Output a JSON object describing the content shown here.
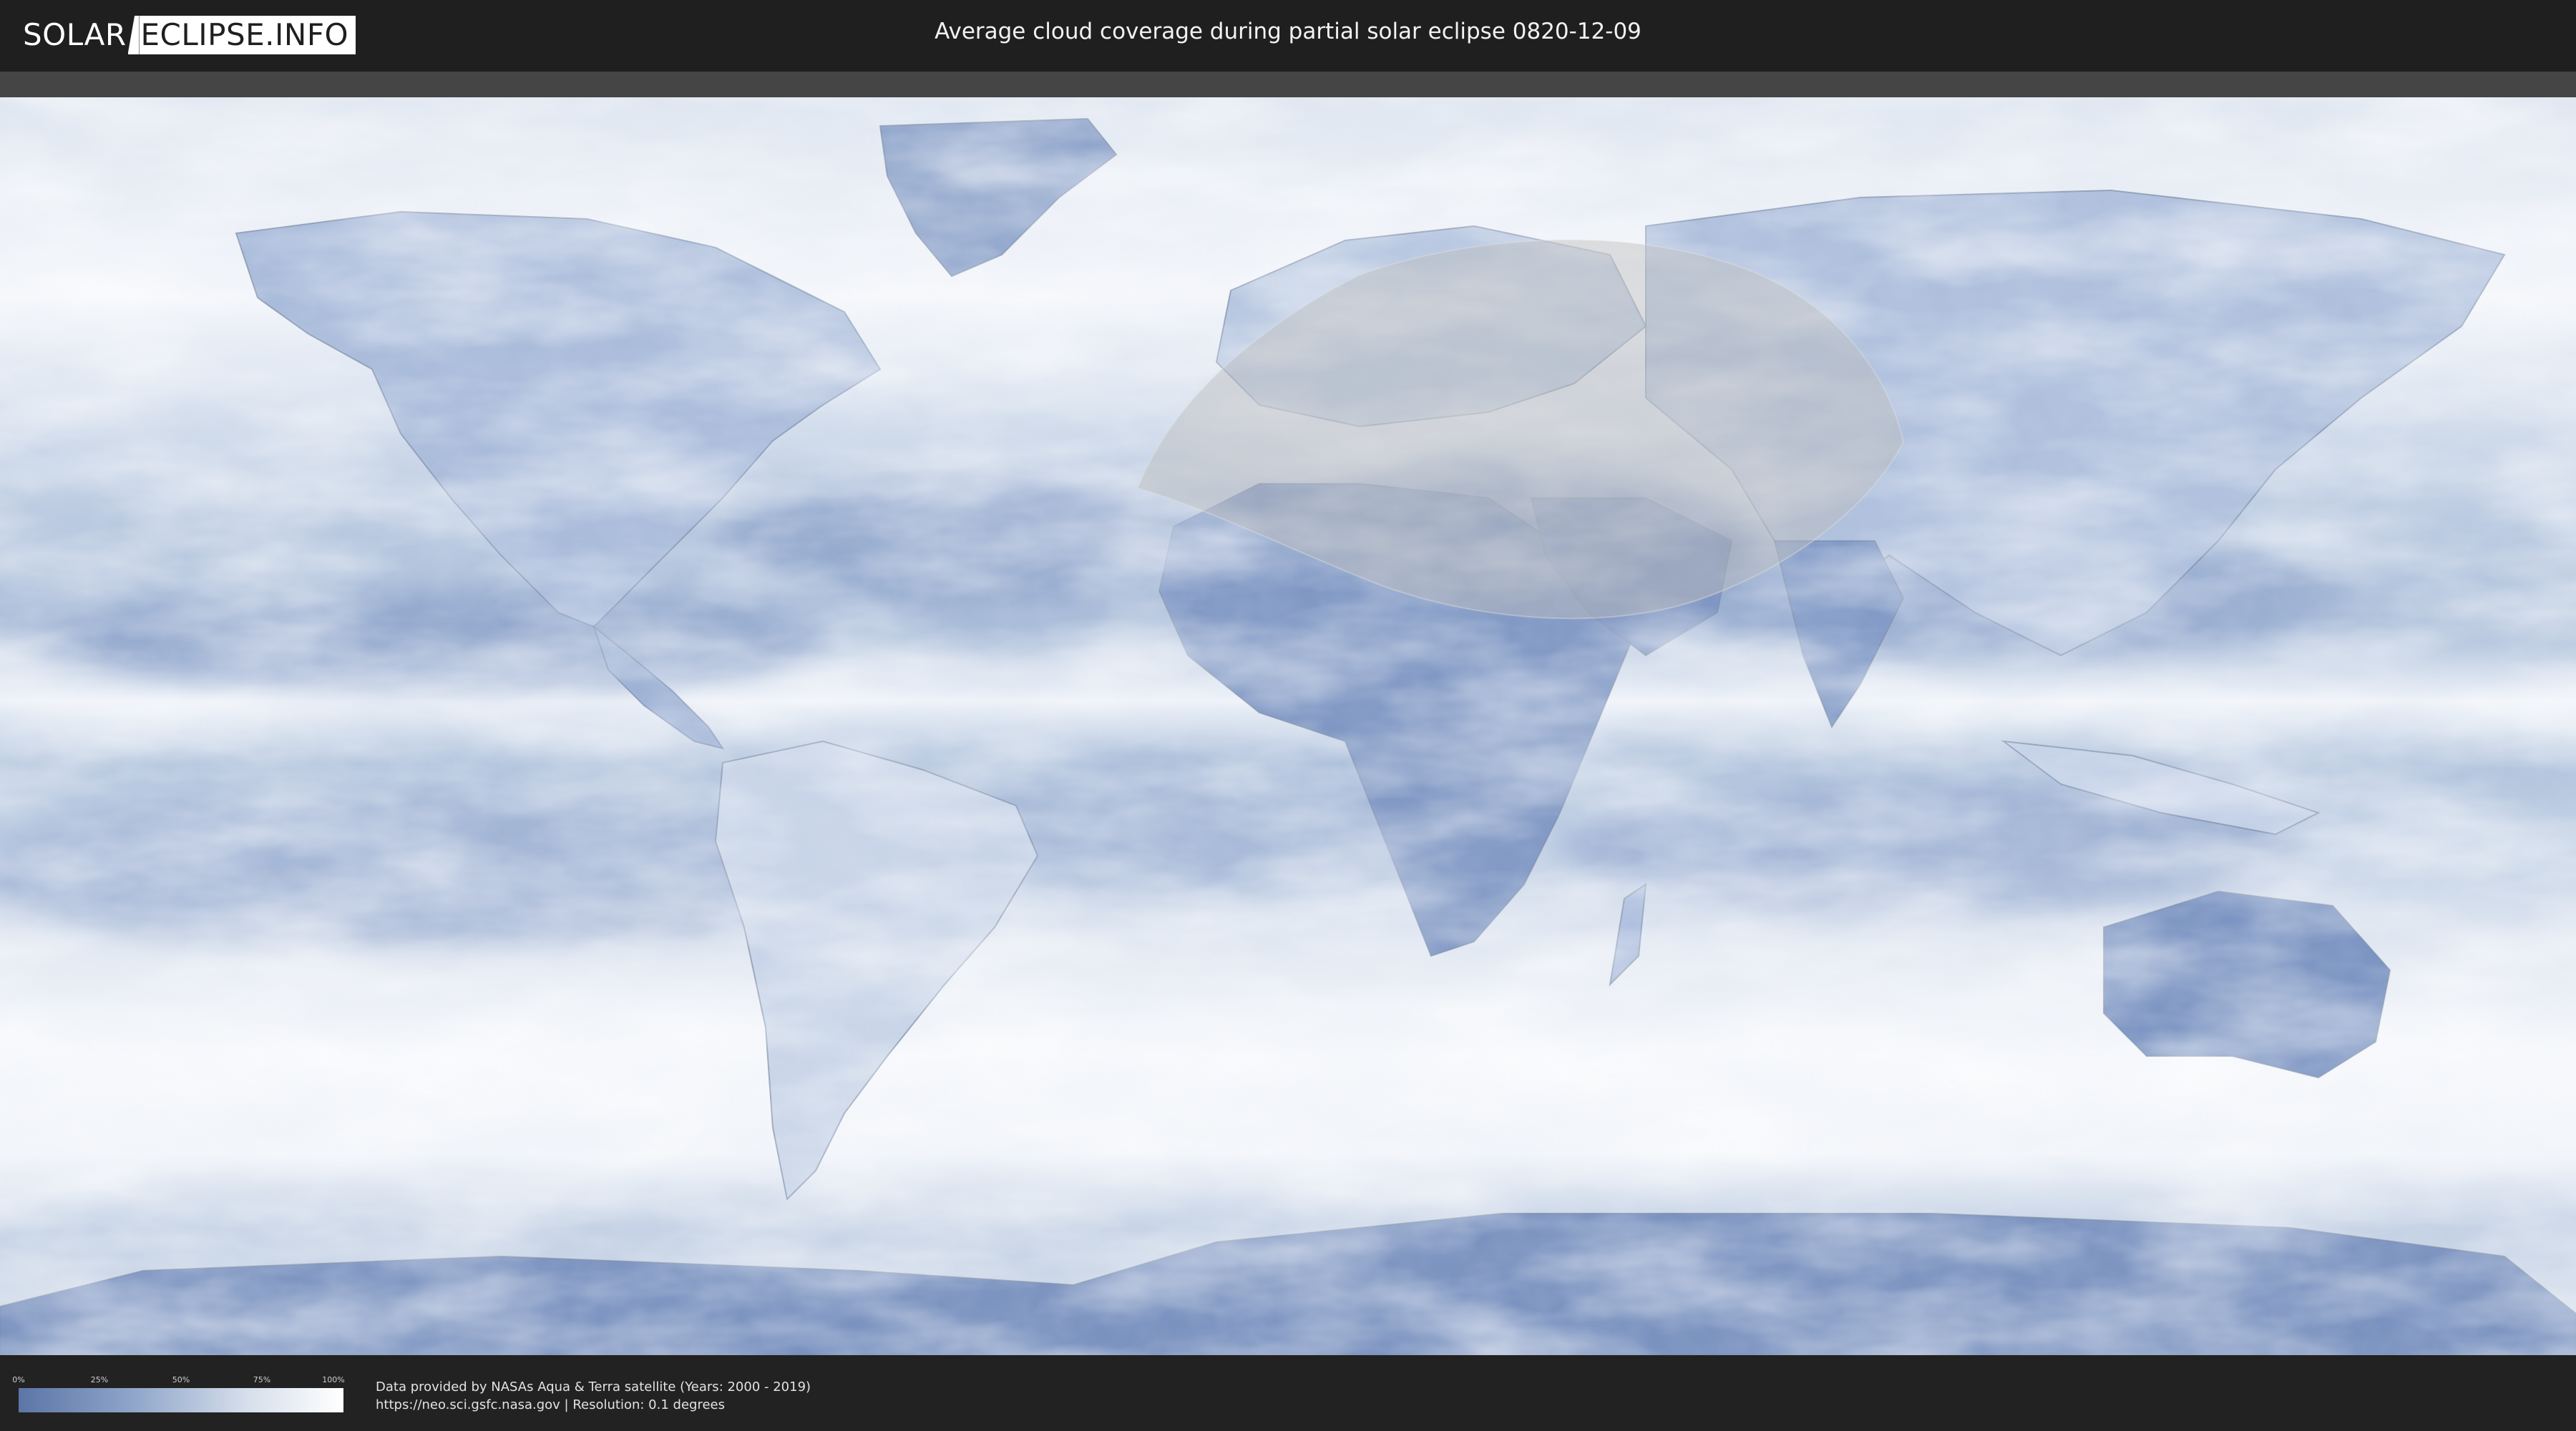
{
  "header": {
    "logo": {
      "part1": "SOLAR",
      "part2": "ECLIPSE.INFO"
    },
    "title": "Average cloud coverage during partial solar eclipse 0820-12-09"
  },
  "map": {
    "projection": "equirectangular",
    "layer": "average cloud coverage",
    "colors": {
      "ocean_clear": "#6c86b6",
      "cloud": "#ffffff",
      "land_clear": "#5d77aa",
      "eclipse_overlay": "#c9c9c9",
      "coastline": "#6b7a93"
    },
    "eclipse_zone": {
      "type": "partial",
      "region": "Europe, North Africa, Middle East, Central Asia"
    }
  },
  "legend": {
    "ticks": [
      "0%",
      "25%",
      "50%",
      "75%",
      "100%"
    ],
    "colors": {
      "low": "#5b75a6",
      "high": "#ffffff"
    }
  },
  "credits": {
    "line1": "Data provided by NASAs Aqua & Terra satellite (Years: 2000 - 2019)",
    "line2": "https://neo.sci.gsfc.nasa.gov | Resolution: 0.1 degrees"
  }
}
